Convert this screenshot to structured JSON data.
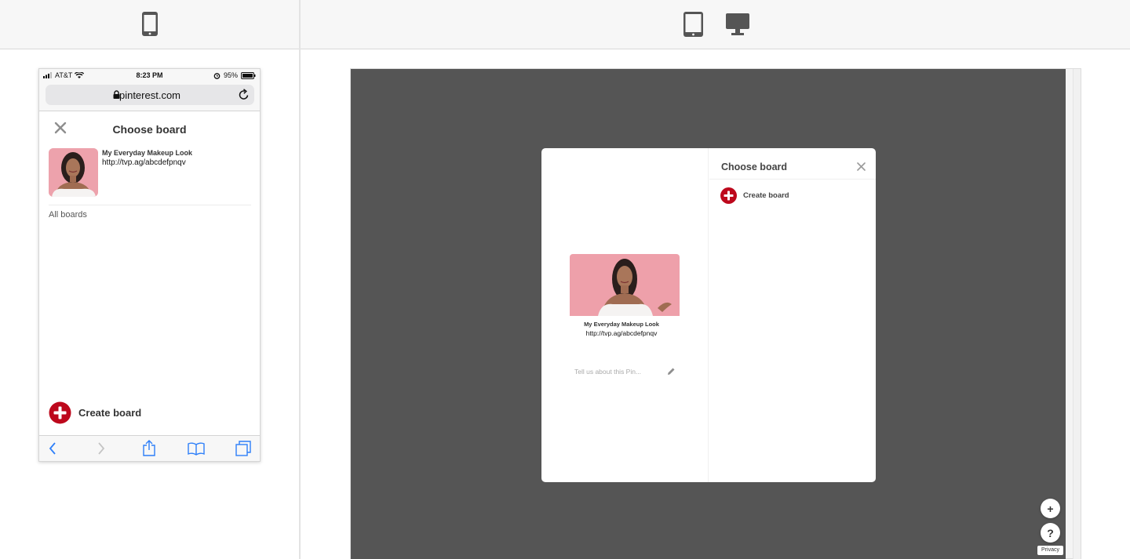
{
  "toolbar": {
    "devices": [
      "phone-icon",
      "tablet-icon",
      "desktop-icon"
    ]
  },
  "mobile": {
    "status": {
      "carrier": "AT&T",
      "time": "8:23 PM",
      "battery": "95%"
    },
    "url": "pinterest.com",
    "title": "Choose board",
    "pin": {
      "title": "My Everyday Makeup Look",
      "url": "http://tvp.ag/abcdefpnqv"
    },
    "all_boards": "All boards",
    "create_board": "Create board",
    "browser_toolbar": [
      "back-icon",
      "forward-icon",
      "share-icon",
      "bookmarks-icon",
      "tabs-icon"
    ]
  },
  "desktop": {
    "title": "Choose board",
    "pin": {
      "title": "My Everyday Makeup Look",
      "url": "http://tvp.ag/abcdefpnqv"
    },
    "description_placeholder": "Tell us about this Pin...",
    "create_board": "Create board",
    "fab_plus": "+",
    "fab_help": "?",
    "privacy": "Privacy"
  },
  "colors": {
    "pinterest_red": "#bd081c",
    "overlay": "#555555",
    "ios_blue": "#2d7ff9"
  }
}
